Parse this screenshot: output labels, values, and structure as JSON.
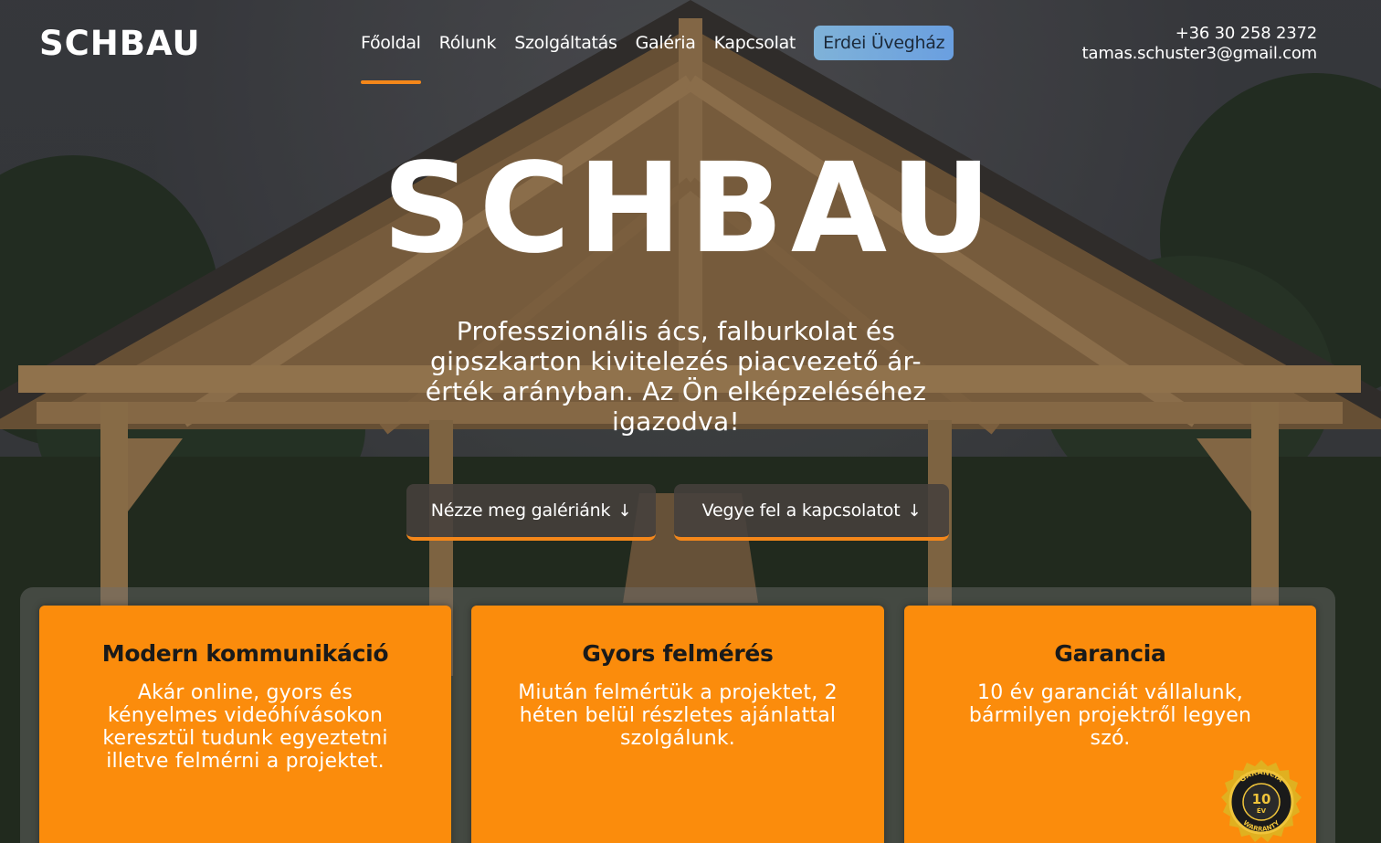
{
  "header": {
    "logo": "SCHBAU",
    "nav": [
      {
        "label": "Főoldal",
        "active": true
      },
      {
        "label": "Rólunk",
        "active": false
      },
      {
        "label": "Szolgáltatás",
        "active": false
      },
      {
        "label": "Galéria",
        "active": false
      },
      {
        "label": "Kapcsolat",
        "active": false
      }
    ],
    "cta_label": "Erdei Üvegház",
    "phone": "+36 30 258 2372",
    "email": "tamas.schuster3@gmail.com"
  },
  "hero": {
    "title": "SCHBAU",
    "subtitle": "Professzionális ács, falburkolat és gipszkarton kivitelezés piacvezető ár-érték arányban. Az Ön elképzeléséhez igazodva!",
    "buttons": [
      {
        "label": "Nézze meg galériánk",
        "icon": "arrow-down-icon"
      },
      {
        "label": "Vegye fel a kapcsolatot",
        "icon": "arrow-down-icon"
      }
    ]
  },
  "features": [
    {
      "title": "Modern kommunikáció",
      "text": "Akár online, gyors és kényelmes videóhívásokon keresztül tudunk egyeztetni illetve felmérni a projektet."
    },
    {
      "title": "Gyors felmérés",
      "text": "Miután felmértük a projektet, 2 héten belül részletes ajánlattal szolgálunk."
    },
    {
      "title": "Garancia",
      "text": "10 év garanciát vállalunk, bármilyen projektről legyen szó."
    }
  ],
  "badge": {
    "top_text": "GARANCIA",
    "number": "10",
    "unit": "ÉV",
    "bottom_text": "WARRANTY"
  },
  "colors": {
    "accent": "#f4871a",
    "card": "#fb8c0c",
    "cta": "#7fb2d8"
  }
}
